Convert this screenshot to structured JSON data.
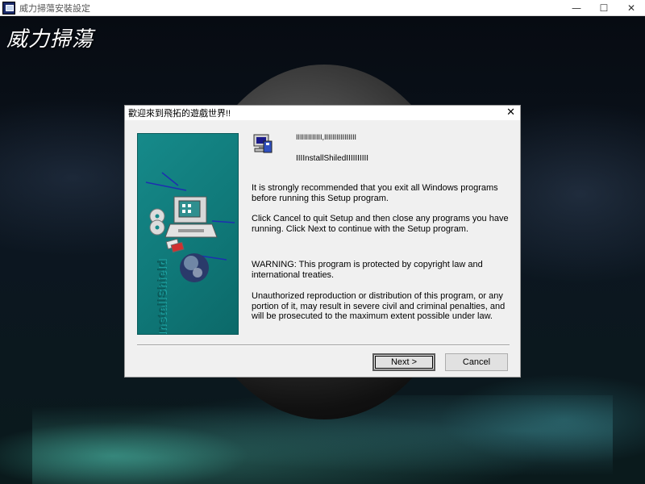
{
  "window": {
    "title": "威力掃蕩安裝設定",
    "controls": {
      "minimize": "—",
      "maximize": "☐",
      "close": "✕"
    }
  },
  "background": {
    "brand": "威力掃蕩"
  },
  "dialog": {
    "title": "歡迎來到飛拓的遊戲世界!!",
    "close": "✕",
    "artwork_label": "InstallShield",
    "line1": "IIIIIIIIIIIII,IIIIIIIIIIIIIIII",
    "line2": "IIIInstallShiledIIIIIIIIII",
    "paragraphs": [
      "It is strongly recommended that you exit all Windows programs before running this Setup program.",
      "Click Cancel to quit Setup and then close any programs you have running.  Click Next to continue with the Setup program.",
      "WARNING: This program is protected by copyright law and international treaties.",
      "Unauthorized reproduction or distribution of this program, or any portion of it, may result in severe civil and criminal penalties, and will be prosecuted to the maximum extent possible under law."
    ],
    "buttons": {
      "next": "Next >",
      "cancel": "Cancel"
    }
  },
  "icons": {
    "app": "installer-app-icon",
    "setup": "setup-computer-icon",
    "art": [
      "cd-disc-icon",
      "floppy-disk-icon",
      "computer-icon",
      "globe-icon"
    ]
  },
  "colors": {
    "art_panel": "#168a8a",
    "dialog_bg": "#f0f0f0"
  }
}
